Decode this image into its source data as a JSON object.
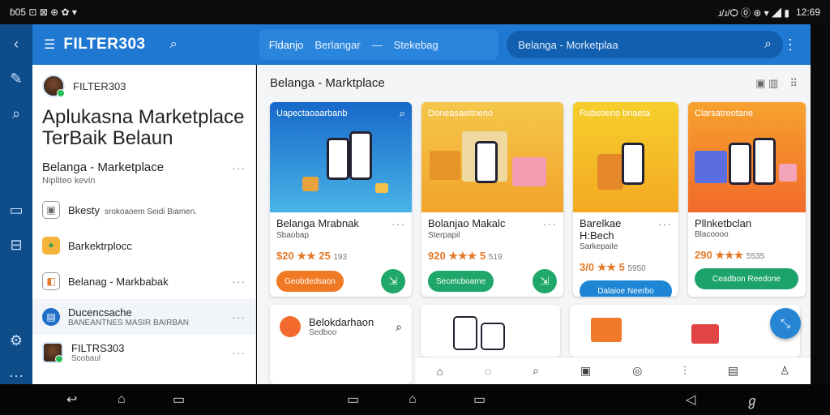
{
  "statusbar": {
    "left": "ɓ05 ⊡ ⊠ ⊕ ✿ ▾",
    "right_icons": "ɹ/ɹ/Ѻ ⓪ ⊛ ▾ ◢ ▮",
    "time": "12:69"
  },
  "app": {
    "brand": "FILTER303"
  },
  "tabs": [
    "Fldanjo",
    "Berlangar",
    "—",
    "Stekebag"
  ],
  "search": {
    "value": "Belanga - Morketplaa"
  },
  "sidebar": {
    "user": "FILTER303",
    "headline": "Aplukasna Marketplace TerBaik Belaun",
    "section": {
      "title": "Belanga - Marketplace",
      "subtitle": "Nipliteo kevin"
    },
    "items": [
      {
        "label": "Bkesty",
        "note": "srokoaoem Seidi Biamen."
      },
      {
        "label": "Barkektrplocc"
      },
      {
        "label": "Belanag - Markbabak"
      },
      {
        "label": "Ducencsache",
        "note": "BANEANTNES MASIR BAIRBAN"
      },
      {
        "label": "FILTRS303",
        "note": "Scobaul"
      }
    ]
  },
  "main": {
    "title": "Belanga - Marktplace",
    "cards": [
      {
        "caption": "Uapectaoaarbanb",
        "name": "Belanga Mrabnak",
        "cat": "Sbaobap",
        "price": "$20",
        "rating": "★★ 25",
        "count": "193",
        "button": "Geobdedsaon",
        "accent": "#f07a24",
        "bg": "linear-gradient(180deg,#1769c9,#48b3e8)"
      },
      {
        "caption": "Doneasaeitneno",
        "name": "Bolanjao Makalc",
        "cat": "Sterpapil",
        "price": "920",
        "rating": "★★★ 5",
        "count": "519",
        "button": "Secetcboame",
        "accent": "#1fa66a",
        "bg": "linear-gradient(180deg,#f4c74a,#f2a32a)"
      },
      {
        "caption": "Rubetieno bnaeta",
        "name": "Barelkae H:Bech",
        "cat": "Sarkepaile",
        "price": "3/0",
        "rating": "★★ 5",
        "count": "5950",
        "button": "Dalaioe Neerbo",
        "accent": "#1f86d6",
        "bg": "linear-gradient(180deg,#f6cf2c,#f3a923)"
      },
      {
        "caption": "Clarsatreotane",
        "name": "Pllnketbclan",
        "cat": "Blacoooo",
        "price": "290",
        "rating": "★★★",
        "count": "5535",
        "button": "Ceadbon Reedone",
        "accent": "#1ca36c",
        "bg": "linear-gradient(180deg,#f7a22e,#f16a2a)"
      }
    ],
    "row2": {
      "title": "Belokdarhaon",
      "sub": "Sedboo"
    }
  }
}
